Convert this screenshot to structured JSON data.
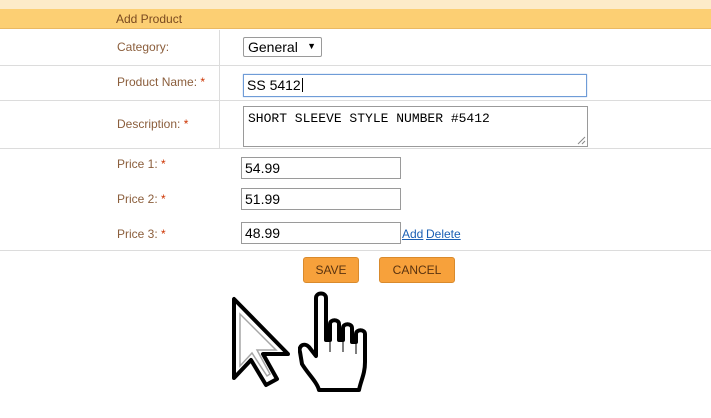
{
  "header": {
    "title": "Add Product"
  },
  "form": {
    "category": {
      "label": "Category:",
      "value": "General"
    },
    "product_name": {
      "label": "Product Name:",
      "required_mark": "*",
      "value": "SS 5412"
    },
    "description": {
      "label": "Description:",
      "required_mark": "*",
      "value": "SHORT SLEEVE STYLE NUMBER #5412"
    },
    "prices": [
      {
        "label": "Price 1:",
        "required_mark": "*",
        "value": "54.99"
      },
      {
        "label": "Price 2:",
        "required_mark": "*",
        "value": "51.99"
      },
      {
        "label": "Price 3:",
        "required_mark": "*",
        "value": "48.99"
      }
    ],
    "add_link": "Add",
    "delete_link": "Delete"
  },
  "actions": {
    "save_label": "SAVE",
    "cancel_label": "CANCEL"
  },
  "icons": {
    "select_arrow": "chevron-down-icon",
    "arrow_cursor": "arrow-cursor-icon",
    "hand_cursor": "hand-pointer-icon"
  },
  "colors": {
    "header_bg": "#fccf73",
    "button_bg": "#f7a13b",
    "label_text": "#8b5e3c",
    "required": "#cc3300",
    "link": "#1a5fb4"
  }
}
